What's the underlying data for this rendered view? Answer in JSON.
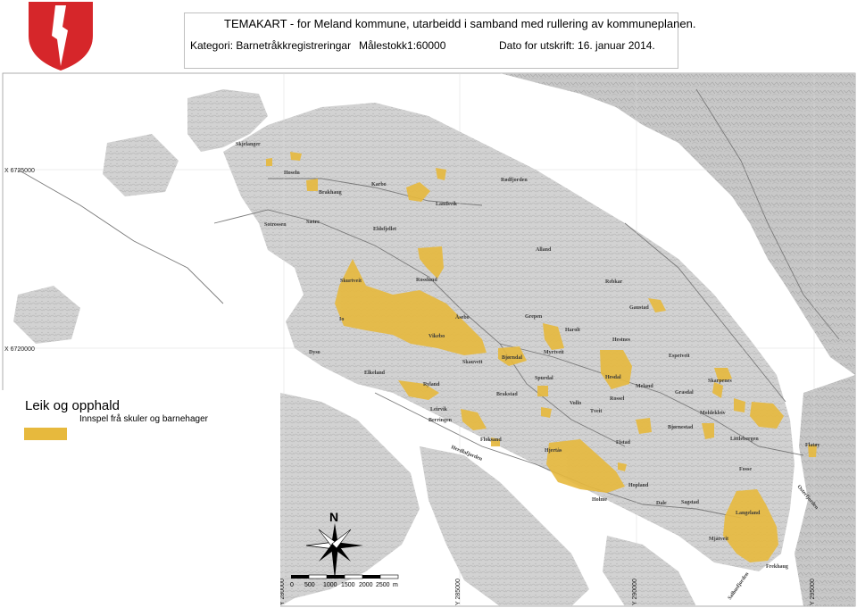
{
  "header": {
    "title": "TEMAKART - for Meland kommune, utarbeidd i samband med rullering av kommuneplanen.",
    "category": "Kategori: Barnetråkkregistreringar",
    "scale": "Målestokk1:60000",
    "date": "Dato for utskrift:  16. januar 2014."
  },
  "legend": {
    "title": "Leik og opphald",
    "item_label": "Innspel frå skuler og barnehager",
    "item_color": "#e7b93d"
  },
  "colors": {
    "water": "#ffffff",
    "land": "#cfcfcf",
    "relief": "#b5b5b5",
    "highlight": "#e7b93d",
    "logo_red": "#d6262a"
  },
  "coordinates": {
    "y1": "X 6725000",
    "y2": "X 6720000",
    "x1": "Y 280000",
    "x2": "Y 285000",
    "x3": "Y 290000",
    "x4": "Y 295000"
  },
  "north_label": "N",
  "scalebar": {
    "ticks": [
      "0",
      "500",
      "1000",
      "1500",
      "2000",
      "2500",
      "m"
    ]
  },
  "places": {
    "skjelanger": "Skjelanger",
    "hoseln": "Hoseln",
    "brakhaug": "Brakhaug",
    "karbo": "Karbo",
    "rodfjorden": "Rødfjorden",
    "landsvik": "Landsvik",
    "sotrossen": "Sotrossen",
    "sotre": "Sætre",
    "eldsfjellet": "Eldsfjellet",
    "alland": "Alland",
    "skurtveit": "Skurtveit",
    "rosslund": "Rosslund",
    "rebkar": "Rebkar",
    "gaustad": "Gaustad",
    "io": "Io",
    "aserbo": "Åsebo",
    "grepen": "Grepen",
    "harolt": "Harolt",
    "vikebo": "Vikebo",
    "dyso": "Dyso",
    "skauvet": "Skauvett",
    "bjorndal": "Bjørndal",
    "myrtveit": "Myrtveit",
    "hestnes": "Hestnes",
    "espetveit": "Espetveit",
    "elkeland": "Elkeland",
    "ryland": "Ryland",
    "spurdal": "Spurdal",
    "hesdal": "Hesdal",
    "meland": "Meland",
    "skarpenes": "Skarpenes",
    "brakstad": "Brakstad",
    "grasdal": "Grasdal",
    "rossel": "Rossel",
    "leirvik": "Leirvik",
    "berringen": "Berringen",
    "vollo": "Vollo",
    "tveit": "Tveit",
    "moldekleiv": "Moldekleiv",
    "bjornestad": "Bjørnestad",
    "floksand": "Floksand",
    "fistad": "Fistad",
    "littlebergen": "Littlebergen",
    "flatoy": "Flatøy",
    "herdlafjorden": "Herdlafjorden",
    "hjertas": "Hjertås",
    "fosse": "Fosse",
    "hopland": "Hopland",
    "holme": "Holme",
    "dale": "Dale",
    "sagstad": "Sagstad",
    "langeland": "Langeland",
    "mjatveit": "Mjåtveit",
    "frekhaug": "Frekhaug",
    "salhusfjorden": "Salhusfjorden",
    "osterfjorden": "Osterfjorden"
  }
}
